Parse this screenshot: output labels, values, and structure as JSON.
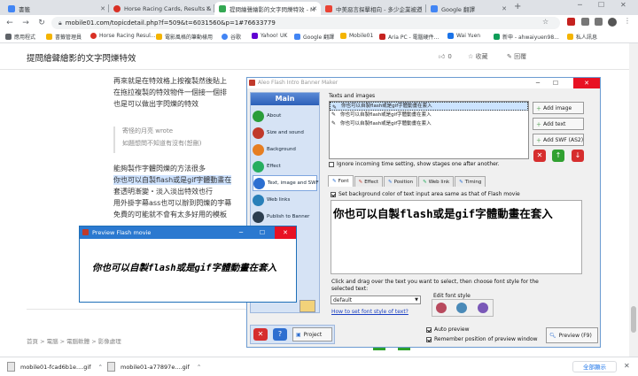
{
  "browser": {
    "tabs": [
      {
        "label": "書籤",
        "color": "#4285f4"
      },
      {
        "label": "Horse Racing Cards, Results & B",
        "color": "#d93025"
      },
      {
        "label": "提問繪聲繪影的文字閃爍特效 - M",
        "color": "#34a853",
        "active": true
      },
      {
        "label": "中美惡言探擊相向 - 多少企業被迫",
        "color": "#ea4335"
      },
      {
        "label": "Google 翻譯",
        "color": "#4285f4"
      }
    ],
    "url": "mobile01.com/topicdetail.php?f=509&t=6031560&p=1#76633779",
    "bookmarks": [
      "應用程式",
      "書籤管理員",
      "Horse Racing Resul...",
      "電影風格的筆動樣用",
      "谷歌",
      "Yahoo! UK",
      "Google 翻譯",
      "Mobile01",
      "Aria PC - 電腦硬件...",
      "Wai Yuen",
      "新申 - ahwaiyuen98...",
      "私人訊息"
    ]
  },
  "page": {
    "title": "提問繪聲繪影的文字閃爍特效",
    "like_count": "0",
    "collect_label": "收藏",
    "reply_label": "回覆",
    "lines": [
      "再來就是在特效格上按複製然後貼上",
      "在拖拉複製的特效物件一個接一個排",
      "也是可以做出字閃爍的特效"
    ],
    "quote_author": "寄怪的月亮 wrote",
    "quote_text": "如題想問不知道有沒有(恕刪)",
    "body": [
      "能夠製作字體閃爍的方法很多",
      "你也可以自製flash或是gif字體動畫在",
      "套透明漸變・淡入淡出特效也行",
      "用外掛字幕ass也可以辦到閃爍的字幕",
      "免費的可能就不會有太多好用的模板"
    ],
    "breadcrumb": "首頁 > 電腦 > 電腦軟體 > 影像處理"
  },
  "app": {
    "title": "Aleo Flash Intro Banner Maker",
    "sidebar_title": "Main",
    "menu": [
      {
        "label": "About",
        "color": "#2a9d3a"
      },
      {
        "label": "Size and sound",
        "color": "#c0392b"
      },
      {
        "label": "Background",
        "color": "#e67e22"
      },
      {
        "label": "Effect",
        "color": "#27ae60"
      },
      {
        "label": "Text, image and SWF",
        "color": "#2c6fd1",
        "selected": true
      },
      {
        "label": "Web links",
        "color": "#2980b9"
      },
      {
        "label": "Publish to Banner",
        "color": "#2c3e50"
      }
    ],
    "texts_label": "Texts and images",
    "items": [
      "你也可以自製flash或是gif字體動畫在套入",
      "你也可以自製flash或是gif字體動畫在套入",
      "你也可以自製flash或是gif字體動畫在套入"
    ],
    "btn_add_image": "Add image",
    "btn_add_text": "Add text",
    "btn_add_swf": "Add SWF (AS2)",
    "ignore_label": "Ignore incoming time setting, show stages one after another.",
    "tabs": [
      "Font",
      "Effect",
      "Position",
      "Web link",
      "Timing"
    ],
    "same_bg_label": "Set background color of text input area same as that of Flash movie",
    "big_text": "你也可以自製flash或是gif字體動畫在套入",
    "drag_hint": "Click and drag over the text you want to select, then choose font style for the selected text:",
    "font_select": "default",
    "edit_font_label": "Edit font style",
    "howto_link": "How to set font style of text?",
    "project_btn": "Project",
    "auto_preview": "Auto preview",
    "remember_pos": "Remember position of preview window",
    "preview_btn": "Preview (F9)"
  },
  "preview": {
    "title": "Preview Flash movie",
    "text": "你也可以自製flash或是gif字體動畫在套入"
  },
  "downloads": {
    "file1": "mobile01-fcad6b1e....gif",
    "file2": "mobile01-a77897e....gif",
    "show_all": "全部顯示"
  }
}
